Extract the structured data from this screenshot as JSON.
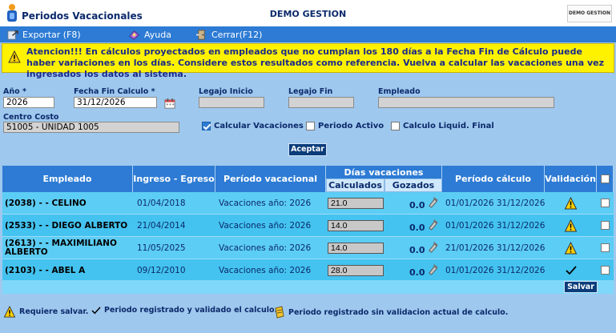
{
  "window": {
    "title": "Periodos Vacacionales",
    "company": "DEMO GESTION",
    "brand_logo_text": "DEMO GESTION"
  },
  "toolbar": {
    "export_label": "Exportar (F8)",
    "help_label": "Ayuda",
    "close_label": "Cerrar(F12)"
  },
  "warning": "Atencion!!! En cálculos proyectados en empleados que no cumplan los 180 días a la Fecha Fin de Cálculo puede haber variaciones en los días. Considere estos resultados como referencia. Vuelva a calcular las vacaciones una vez ingresados los datos al sistema.",
  "filters": {
    "anio_label": "Año *",
    "anio_value": "2026",
    "fecha_fin_label": "Fecha Fin Calculo *",
    "fecha_fin_value": "31/12/2026",
    "legajo_inicio_label": "Legajo Inicio",
    "legajo_inicio_value": "",
    "legajo_fin_label": "Legajo Fin",
    "legajo_fin_value": "",
    "empleado_label": "Empleado",
    "empleado_value": "",
    "centro_costo_label": "Centro Costo",
    "centro_costo_value": "51005 - UNIDAD 1005",
    "calcular_vacaciones_label": "Calcular Vacaciones",
    "periodo_activo_label": "Periodo Activo",
    "calculo_liquid_label": "Calculo Liquid. Final",
    "aceptar_label": "Aceptar"
  },
  "grid": {
    "headers": {
      "empleado": "Empleado",
      "ingreso_egreso": "Ingreso - Egreso",
      "periodo_vacacional": "Período vacacional",
      "dias_vacaciones": "Días vacaciones",
      "calculados": "Calculados",
      "gozados": "Gozados",
      "periodo_calculo": "Período cálculo",
      "validacion": "Validación"
    },
    "rows": [
      {
        "empleado": "(2038) - - CELINO",
        "ingreso": "01/04/2018",
        "periodo": "Vacaciones año: 2026",
        "calculados": "21.0",
        "gozados": "0.0",
        "periodo_calculo": "01/01/2026 31/12/2026",
        "validacion": "warning"
      },
      {
        "empleado": "(2533) - - DIEGO ALBERTO",
        "ingreso": "21/04/2014",
        "periodo": "Vacaciones año: 2026",
        "calculados": "14.0",
        "gozados": "0.0",
        "periodo_calculo": "01/01/2026 31/12/2026",
        "validacion": "warning"
      },
      {
        "empleado": "(2613) - - MAXIMILIANO ALBERTO",
        "ingreso": "11/05/2025",
        "periodo": "Vacaciones año: 2026",
        "calculados": "14.0",
        "gozados": "0.0",
        "periodo_calculo": "21/01/2026 31/12/2026",
        "validacion": "warning"
      },
      {
        "empleado": "(2103) - - ABEL A",
        "ingreso": "09/12/2010",
        "periodo": "Vacaciones año: 2026",
        "calculados": "28.0",
        "gozados": "0.0",
        "periodo_calculo": "01/01/2026 31/12/2026",
        "validacion": "check"
      }
    ],
    "salvar_label": "Salvar"
  },
  "legend": {
    "requiere_salvar": "Requiere salvar.",
    "registrado_validado": "Periodo registrado y validado el calculo.",
    "registrado_sin_validacion": "Periodo registrado sin validacion actual de calculo."
  },
  "colors": {
    "toolbar": "#2d7bd4",
    "background": "#9fc8ee",
    "warning": "#fff200",
    "row": "#5ccdf5",
    "header": "#2d7bd4"
  }
}
